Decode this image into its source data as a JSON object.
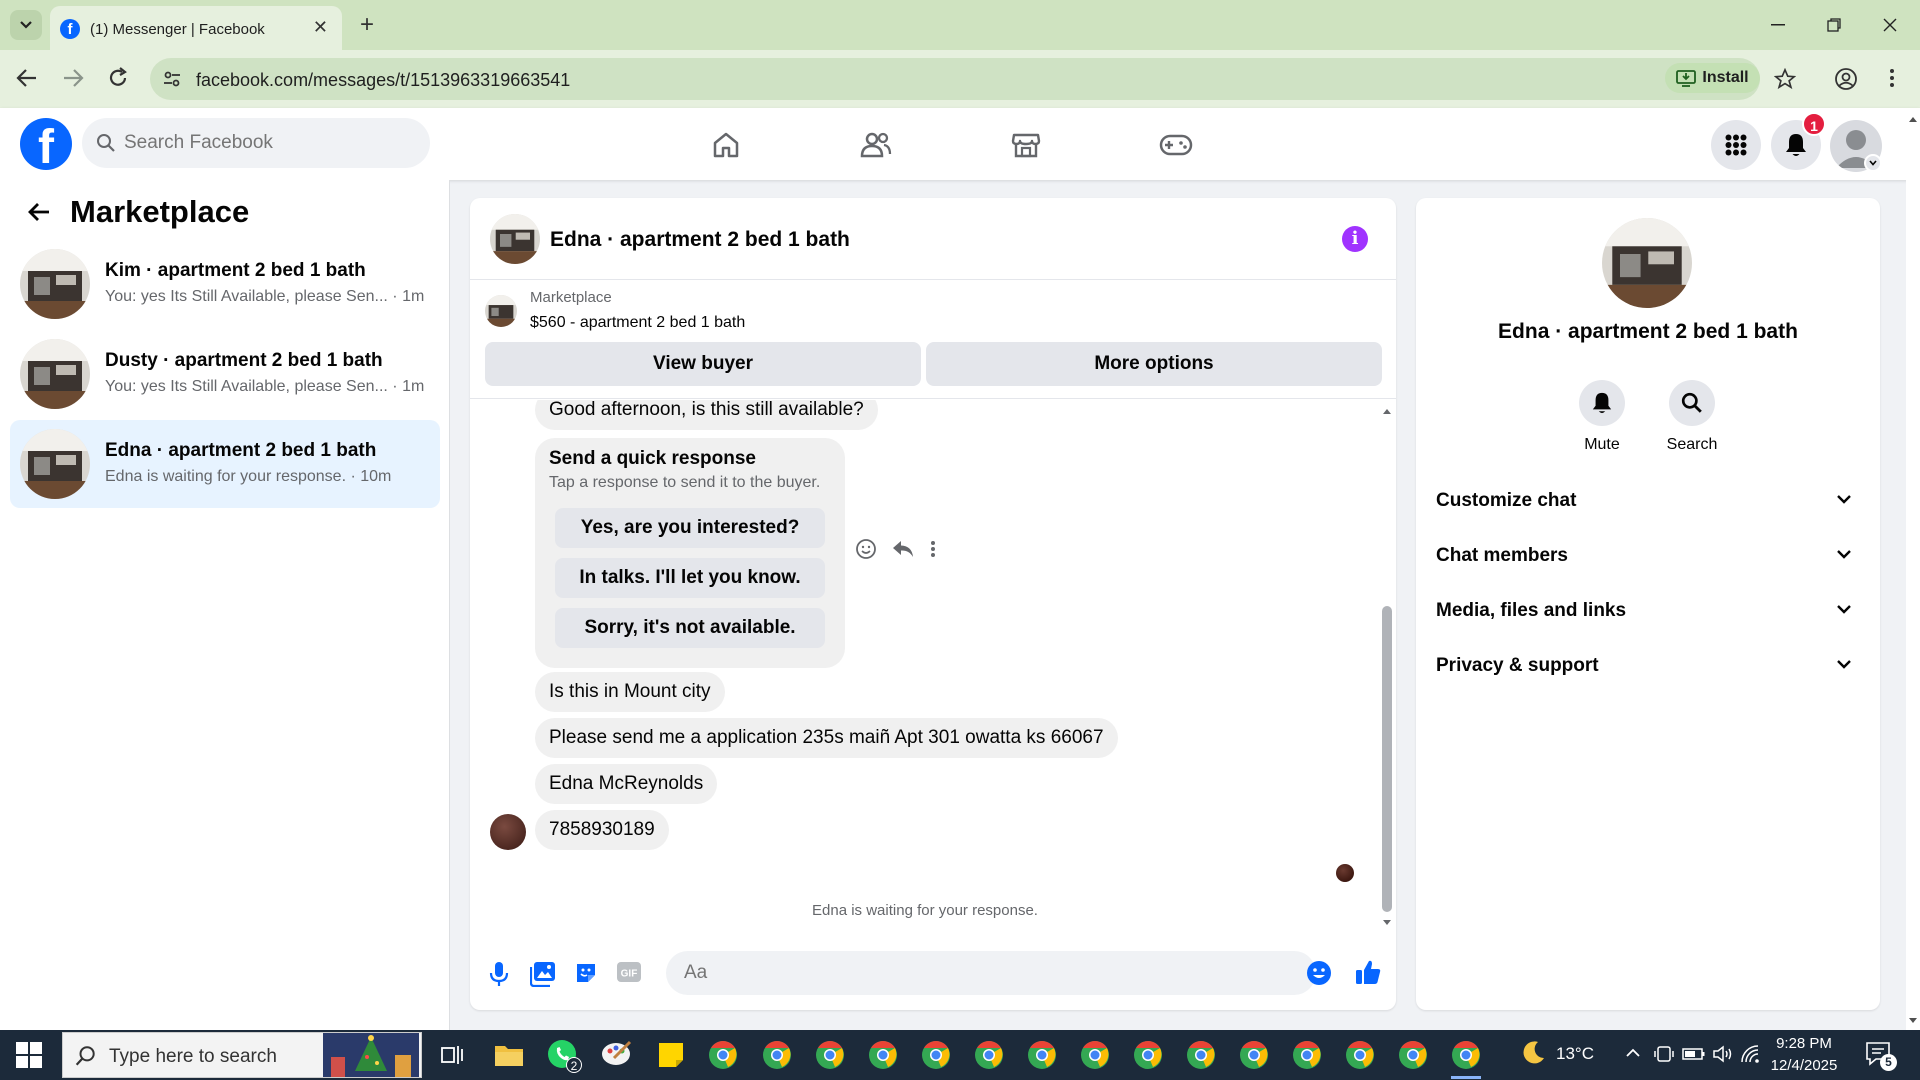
{
  "browser": {
    "tab_title": "(1) Messenger | Facebook",
    "url": "facebook.com/messages/t/1513963319663541",
    "install_label": "Install"
  },
  "header": {
    "search_placeholder": "Search Facebook",
    "notification_count": "1"
  },
  "sidebar": {
    "title": "Marketplace",
    "conversations": [
      {
        "name": "Kim · apartment 2 bed 1 bath",
        "preview": "You: yes Its Still Available, please Sen...",
        "time": " · 1m"
      },
      {
        "name": "Dusty · apartment 2 bed 1 bath",
        "preview": "You: yes Its Still Available, please Sen...",
        "time": " · 1m"
      },
      {
        "name": "Edna · apartment 2 bed 1 bath",
        "preview": "Edna is waiting for your response.",
        "time": " · 10m"
      }
    ]
  },
  "chat": {
    "title": "Edna · apartment 2 bed 1 bath",
    "listing_source": "Marketplace",
    "listing_price_title": "$560 - apartment 2 bed 1 bath",
    "view_buyer_label": "View buyer",
    "more_options_label": "More options",
    "messages": [
      "Good afternoon, is this still available?",
      "Is this in Mount city",
      "Please send me a application 235s maiñ Apt 301 owatta ks 66067",
      "Edna McReynolds",
      "7858930189"
    ],
    "quick_response": {
      "title": "Send a quick response",
      "subtitle": "Tap a response to send it to the buyer.",
      "options": [
        "Yes, are you interested?",
        "In talks. I'll let you know.",
        "Sorry, it's not available."
      ]
    },
    "waiting_text": "Edna is waiting for your response.",
    "input_placeholder": "Aa"
  },
  "info_panel": {
    "name": "Edna · apartment 2 bed 1 bath",
    "mute_label": "Mute",
    "search_label": "Search",
    "sections": [
      "Customize chat",
      "Chat members",
      "Media, files and links",
      "Privacy & support"
    ]
  },
  "taskbar": {
    "search_placeholder": "Type here to search",
    "whatsapp_badge": "2",
    "temperature": "13°C",
    "time": "9:28 PM",
    "date": "12/4/2025",
    "notification_count": "5"
  },
  "colors": {
    "fb_blue": "#0866ff",
    "active_conversation": "#e7f3ff",
    "info_accent": "#a033ff",
    "badge_red": "#e41e3f",
    "browser_frame": "#cfe3c0"
  }
}
